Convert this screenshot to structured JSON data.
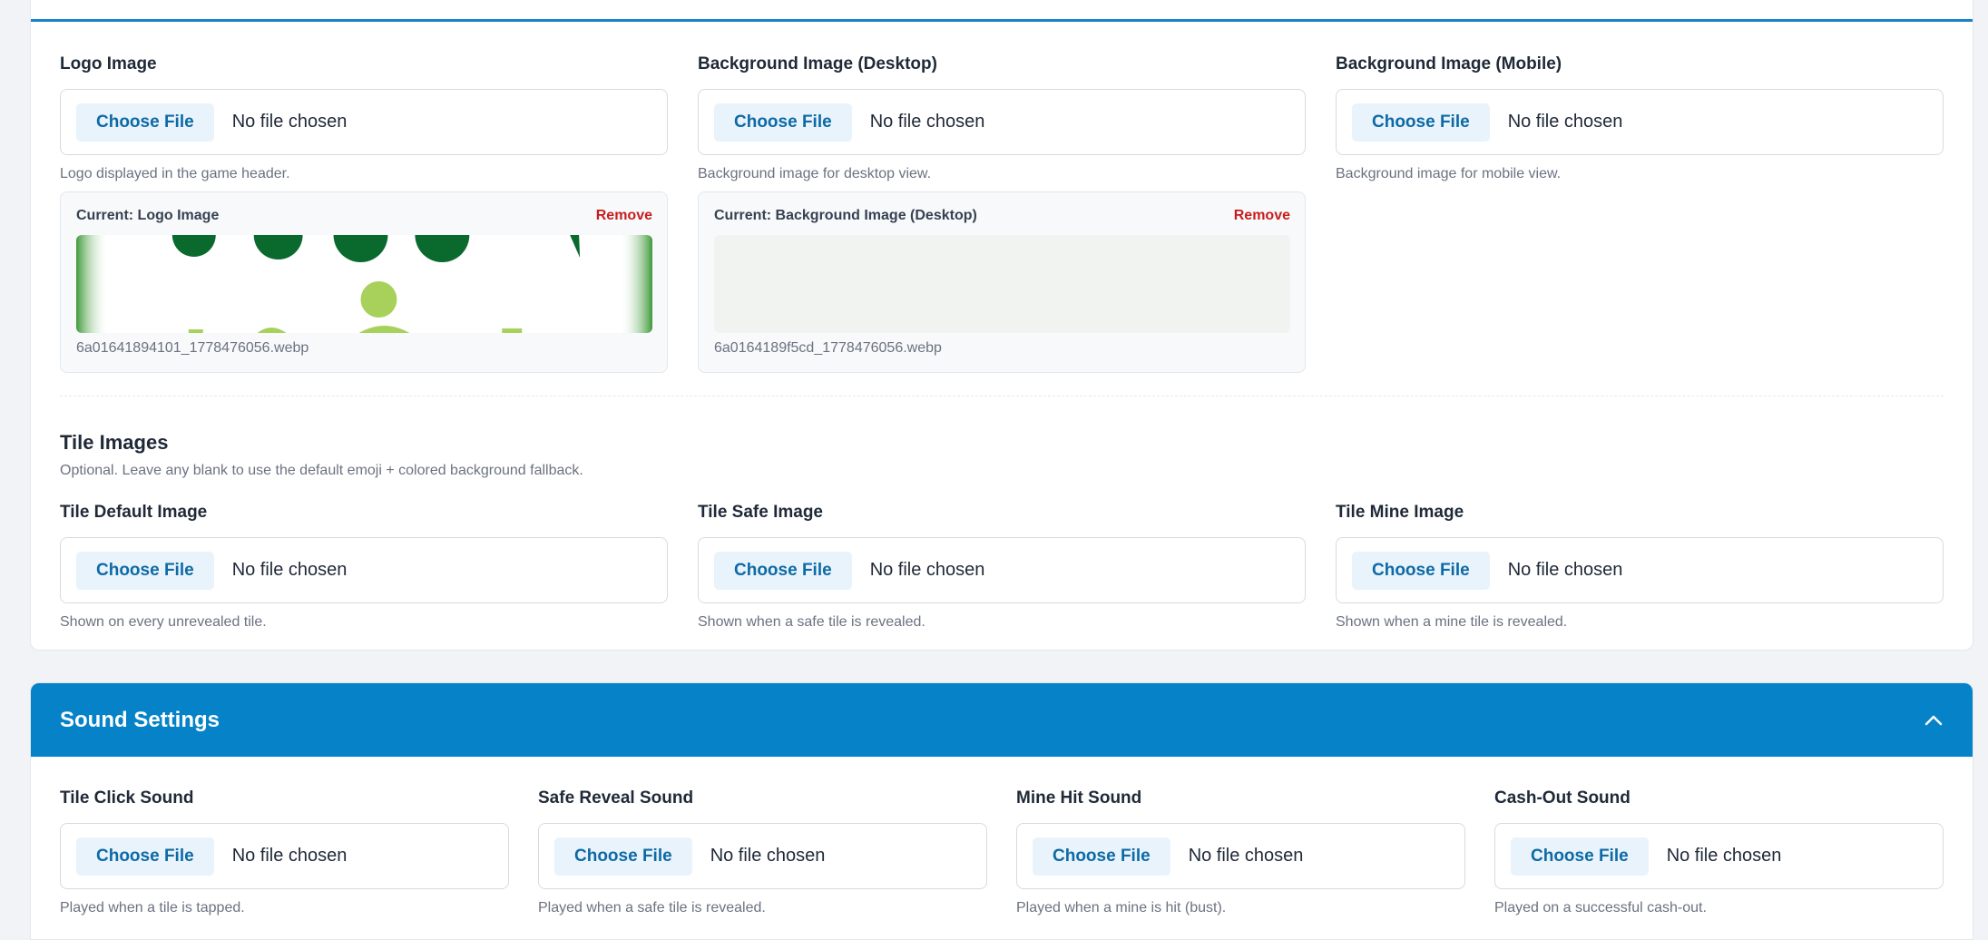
{
  "branding": {
    "fields": [
      {
        "label": "Logo Image",
        "choose_label": "Choose File",
        "status": "No file chosen",
        "help": "Logo displayed in the game header."
      },
      {
        "label": "Background Image (Desktop)",
        "choose_label": "Choose File",
        "status": "No file chosen",
        "help": "Background image for desktop view."
      },
      {
        "label": "Background Image (Mobile)",
        "choose_label": "Choose File",
        "status": "No file chosen",
        "help": "Background image for mobile view."
      }
    ],
    "previews": [
      {
        "title": "Current: Logo Image",
        "remove_label": "Remove",
        "filename": "6a01641894101_1778476056.webp"
      },
      {
        "title": "Current: Background Image (Desktop)",
        "remove_label": "Remove",
        "filename": "6a0164189f5cd_1778476056.webp"
      }
    ]
  },
  "tile_images": {
    "title": "Tile Images",
    "subtitle": "Optional. Leave any blank to use the default emoji + colored background fallback.",
    "fields": [
      {
        "label": "Tile Default Image",
        "choose_label": "Choose File",
        "status": "No file chosen",
        "help": "Shown on every unrevealed tile."
      },
      {
        "label": "Tile Safe Image",
        "choose_label": "Choose File",
        "status": "No file chosen",
        "help": "Shown when a safe tile is revealed."
      },
      {
        "label": "Tile Mine Image",
        "choose_label": "Choose File",
        "status": "No file chosen",
        "help": "Shown when a mine tile is revealed."
      }
    ]
  },
  "sound_settings": {
    "title": "Sound Settings",
    "toggle_icon": "chevron-up-icon",
    "fields": [
      {
        "label": "Tile Click Sound",
        "choose_label": "Choose File",
        "status": "No file chosen",
        "help": "Played when a tile is tapped."
      },
      {
        "label": "Safe Reveal Sound",
        "choose_label": "Choose File",
        "status": "No file chosen",
        "help": "Played when a safe tile is revealed."
      },
      {
        "label": "Mine Hit Sound",
        "choose_label": "Choose File",
        "status": "No file chosen",
        "help": "Played when a mine is hit (bust)."
      },
      {
        "label": "Cash-Out Sound",
        "choose_label": "Choose File",
        "status": "No file chosen",
        "help": "Played on a successful cash-out."
      }
    ]
  },
  "colors": {
    "accent": "#0582c8",
    "button_bg": "#e9f3fb",
    "button_text": "#0d6aa6",
    "danger": "#c81e1e"
  }
}
